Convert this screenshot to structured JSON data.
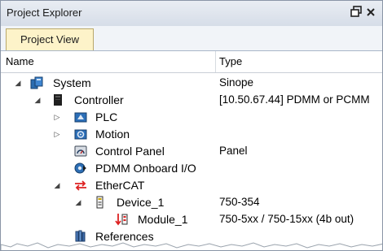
{
  "window": {
    "title": "Project Explorer",
    "pin_glyph": "❐",
    "close_glyph": "✕"
  },
  "tabs": [
    {
      "label": "Project View",
      "active": true
    }
  ],
  "columns": {
    "name": "Name",
    "type": "Type"
  },
  "tree": [
    {
      "label": "System",
      "type": "Sinope",
      "expander": "expanded",
      "icon": "system-icon"
    },
    {
      "label": "Controller",
      "type": "[10.50.67.44] PDMM or PCMM",
      "expander": "expanded",
      "icon": "controller-icon"
    },
    {
      "label": "PLC",
      "type": "",
      "expander": "collapsed",
      "icon": "plc-icon"
    },
    {
      "label": "Motion",
      "type": "",
      "expander": "collapsed",
      "icon": "motion-icon"
    },
    {
      "label": "Control Panel",
      "type": "Panel",
      "expander": "none",
      "icon": "control-panel-icon"
    },
    {
      "label": "PDMM Onboard I/O",
      "type": "",
      "expander": "none",
      "icon": "onboard-io-icon"
    },
    {
      "label": "EtherCAT",
      "type": "",
      "expander": "expanded",
      "icon": "ethercat-icon"
    },
    {
      "label": "Device_1",
      "type": "750-354",
      "expander": "expanded",
      "icon": "device-icon"
    },
    {
      "label": "Module_1",
      "type": "750-5xx / 750-15xx (4b out)",
      "expander": "none",
      "icon": "module-icon"
    },
    {
      "label": "References",
      "type": "",
      "expander": "none",
      "icon": "references-icon"
    }
  ]
}
